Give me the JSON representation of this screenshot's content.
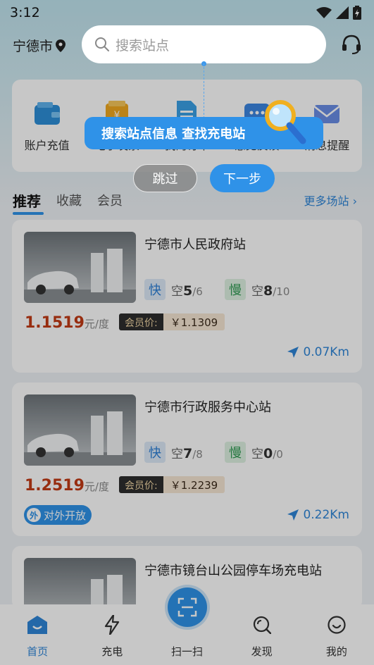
{
  "status_bar": {
    "time": "3:12"
  },
  "header": {
    "city": "宁德市",
    "search_placeholder": "搜索站点"
  },
  "tools": [
    {
      "label": "账户充值",
      "icon": "wallet-icon"
    },
    {
      "label": "电子发票",
      "icon": "invoice-icon"
    },
    {
      "label": "我的订单",
      "icon": "order-icon"
    },
    {
      "label": "意见反馈",
      "icon": "feedback-icon"
    },
    {
      "label": "消息提醒",
      "icon": "message-icon"
    }
  ],
  "tabs": {
    "recommend": "推荐",
    "favorite": "收藏",
    "member": "会员",
    "more": "更多场站"
  },
  "stations": [
    {
      "name": "宁德市人民政府站",
      "fast_label": "快",
      "fast_free_label": "空",
      "fast_free": "5",
      "fast_total": "/6",
      "slow_label": "慢",
      "slow_free_label": "空",
      "slow_free": "8",
      "slow_total": "/10",
      "price": "1.1519",
      "unit": "元/度",
      "member_label": "会员价:",
      "member_price": "￥1.1309",
      "distance": "0.07Km"
    },
    {
      "name": "宁德市行政服务中心站",
      "fast_label": "快",
      "fast_free_label": "空",
      "fast_free": "7",
      "fast_total": "/8",
      "slow_label": "慢",
      "slow_free_label": "空",
      "slow_free": "0",
      "slow_total": "/0",
      "price": "1.2519",
      "unit": "元/度",
      "member_label": "会员价:",
      "member_price": "￥1.2239",
      "distance": "0.22Km",
      "badge": "对外开放",
      "badge_icon_text": "外"
    },
    {
      "name": "宁德市镜台山公园停车场充电站"
    }
  ],
  "guide": {
    "text": "搜索站点信息 查找充电站",
    "skip": "跳过",
    "next": "下一步"
  },
  "bottom_nav": {
    "home": "首页",
    "charge": "充电",
    "scan": "扫一扫",
    "discover": "发现",
    "mine": "我的"
  },
  "colors": {
    "accent": "#2f92e8",
    "price": "#c23a15",
    "fast": "#2c7fd6",
    "slow": "#2f9a52"
  }
}
